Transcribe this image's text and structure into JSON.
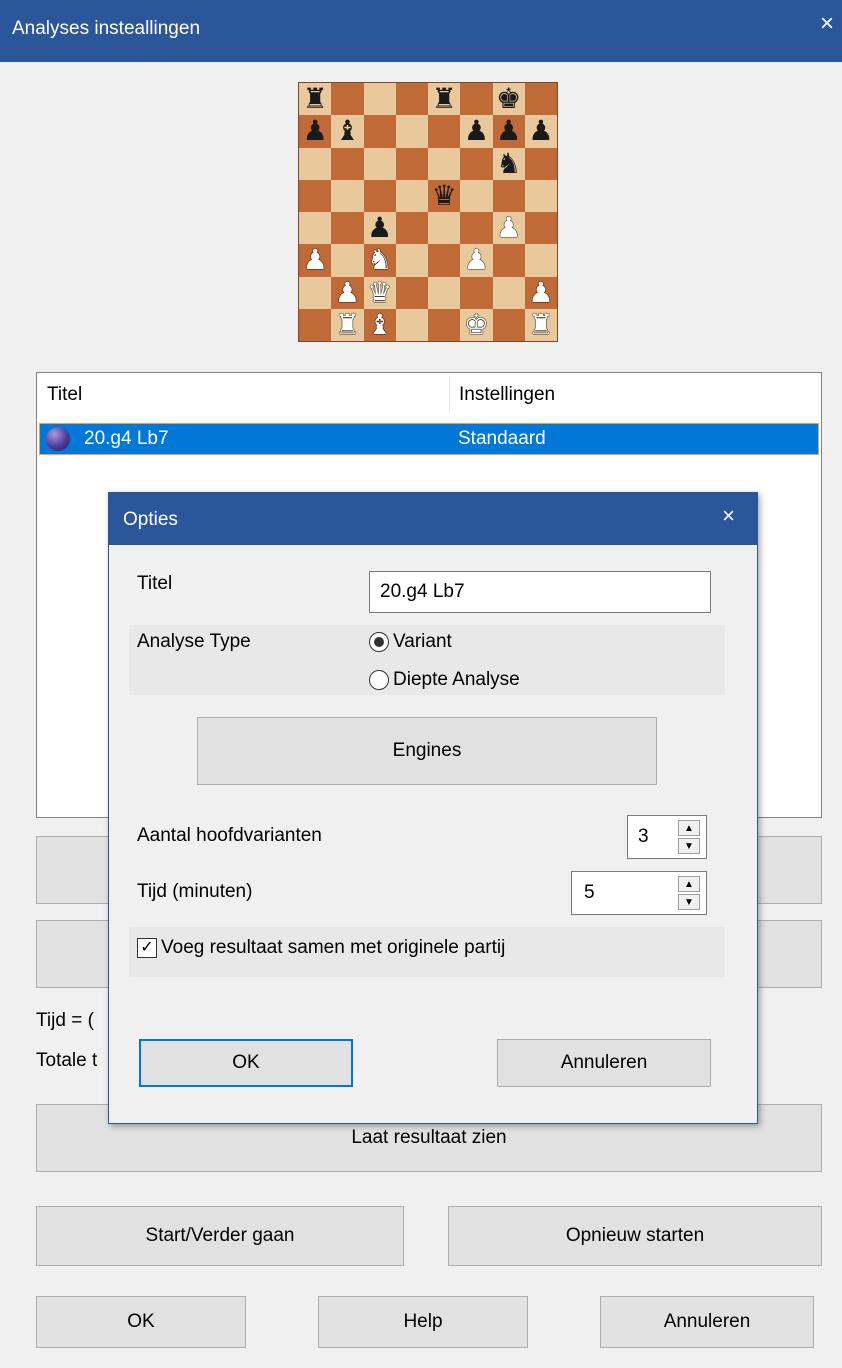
{
  "window": {
    "title": "Analyses insteallingen",
    "close": "×"
  },
  "board": {
    "rows": [
      [
        "bR",
        "",
        "",
        "",
        "bR",
        "",
        "bK",
        ""
      ],
      [
        "bP",
        "bB",
        "",
        "",
        "",
        "bP",
        "bP",
        "bP"
      ],
      [
        "",
        "",
        "",
        "",
        "",
        "",
        "bN",
        ""
      ],
      [
        "",
        "",
        "",
        "",
        "bQ",
        "",
        "",
        ""
      ],
      [
        "",
        "",
        "bP",
        "",
        "",
        "",
        "wP",
        ""
      ],
      [
        "wP",
        "",
        "wN",
        "",
        "",
        "wP",
        "",
        ""
      ],
      [
        "",
        "wP",
        "wQ",
        "",
        "",
        "",
        "",
        "wP"
      ],
      [
        "",
        "wR",
        "wB",
        "",
        "",
        "wK",
        "",
        "wR"
      ]
    ]
  },
  "list": {
    "col_title": "Titel",
    "col_settings": "Instellingen",
    "rows": [
      {
        "title": "20.g4 Lb7",
        "settings": "Standaard"
      }
    ]
  },
  "behind": {
    "tijd": "Tijd = (",
    "totale": "Totale t",
    "show_results": "Laat resultaat zien",
    "start": "Start/Verder gaan",
    "restart": "Opnieuw starten",
    "ok": "OK",
    "help": "Help",
    "cancel": "Annuleren"
  },
  "dialog": {
    "title": "Opties",
    "close": "×",
    "title_label": "Titel",
    "title_value": "20.g4 Lb7",
    "type_label": "Analyse Type",
    "radio_variant": "Variant",
    "radio_deep": "Diepte Analyse",
    "engines": "Engines",
    "variants_label": "Aantal hoofdvarianten",
    "variants_value": "3",
    "time_label": "Tijd (minuten)",
    "time_value": "5",
    "merge_label": "Voeg resultaat samen met originele partij",
    "merge_checked": true,
    "ok": "OK",
    "cancel": "Annuleren"
  },
  "colors": {
    "titlebar": "#2b579a",
    "selection": "#0078d7",
    "board_light": "#e9c89b",
    "board_dark": "#c06a37"
  }
}
